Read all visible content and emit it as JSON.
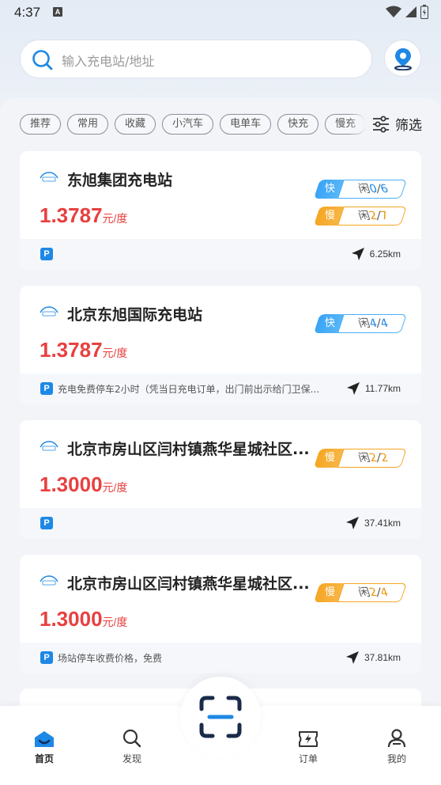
{
  "status_bar": {
    "time": "4:37",
    "notification_icon": "A"
  },
  "search": {
    "placeholder": "输入充电站/地址"
  },
  "filters": {
    "chips": [
      "推荐",
      "常用",
      "收藏",
      "小汽车",
      "电单车",
      "快充",
      "慢充"
    ],
    "filter_label": "筛选"
  },
  "stations": [
    {
      "name": "东旭集团充电站",
      "price": "1.3787",
      "unit": "元/度",
      "fast": {
        "label": "快",
        "prefix": "闲",
        "free": "0",
        "total": "6"
      },
      "slow": {
        "label": "慢",
        "prefix": "闲",
        "free": "2",
        "total": "7"
      },
      "parking_note": "",
      "distance": "6.25km"
    },
    {
      "name": "北京东旭国际充电站",
      "price": "1.3787",
      "unit": "元/度",
      "fast": {
        "label": "快",
        "prefix": "闲",
        "free": "4",
        "total": "4"
      },
      "parking_note": "充电免费停车2小时（凭当日充电订单，出门前出示给门卫保...",
      "distance": "11.77km"
    },
    {
      "name": "北京市房山区闫村镇燕华星城社区...",
      "price": "1.3000",
      "unit": "元/度",
      "slow": {
        "label": "慢",
        "prefix": "闲",
        "free": "2",
        "total": "2"
      },
      "parking_note": "",
      "distance": "37.41km"
    },
    {
      "name": "北京市房山区闫村镇燕华星城社区...",
      "price": "1.3000",
      "unit": "元/度",
      "slow": {
        "label": "慢",
        "prefix": "闲",
        "free": "2",
        "total": "4"
      },
      "parking_note": "场站停车收费价格，免费",
      "distance": "37.81km"
    }
  ],
  "parking_icon": "P",
  "bottom_nav": {
    "home": "首页",
    "discover": "发现",
    "orders": "订单",
    "mine": "我的"
  },
  "colors": {
    "accent": "#1e88e5",
    "price": "#e8403f",
    "fast": "#39a4f5",
    "slow": "#f5a623"
  }
}
